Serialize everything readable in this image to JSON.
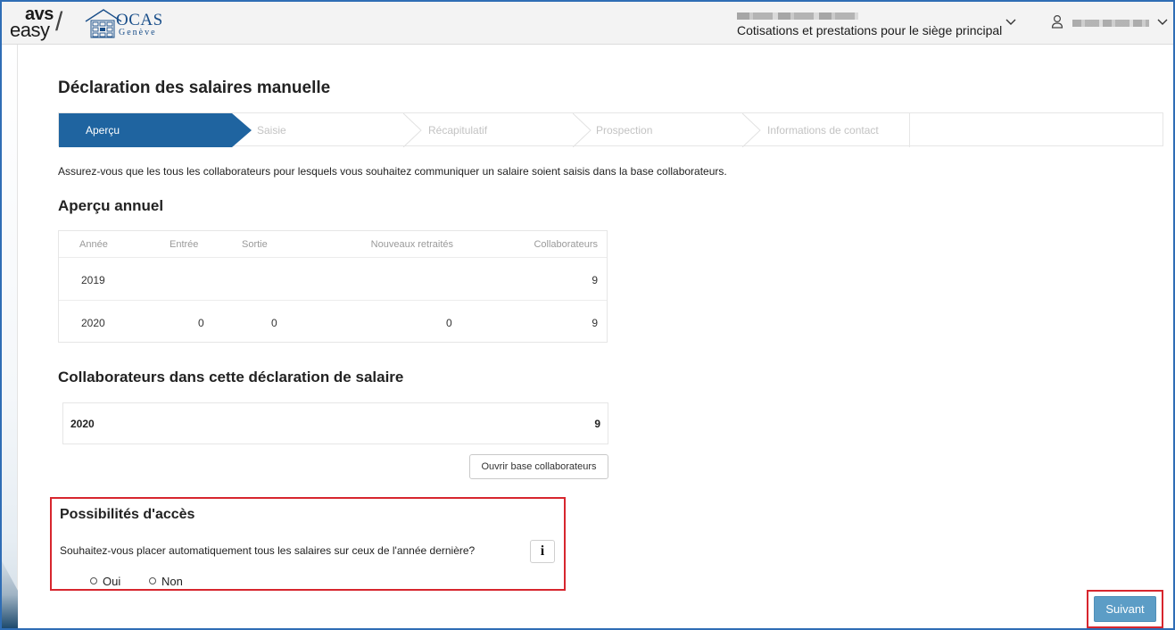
{
  "header": {
    "logo_avs": "avs",
    "logo_easy": "easy",
    "logo_slash": "/",
    "logo_ocas_name": "OCAS",
    "logo_ocas_city": "Genève",
    "org_subtitle": "Cotisations et prestations pour le siège principal"
  },
  "page": {
    "title": "Déclaration des salaires manuelle",
    "info_text": "Assurez-vous que les tous les collaborateurs pour lesquels vous souhaitez communiquer un salaire soient saisis dans la base collaborateurs."
  },
  "stepper": {
    "steps": [
      {
        "label": "Aperçu",
        "active": true
      },
      {
        "label": "Saisie",
        "active": false
      },
      {
        "label": "Récapitulatif",
        "active": false
      },
      {
        "label": "Prospection",
        "active": false
      },
      {
        "label": "Informations de contact",
        "active": false
      }
    ],
    "active_color": "#1f64a0"
  },
  "annual": {
    "heading": "Aperçu annuel",
    "columns": [
      "Année",
      "Entrée",
      "Sortie",
      "Nouveaux retraités",
      "Collaborateurs"
    ],
    "rows": [
      [
        "2019",
        "",
        "",
        "",
        "9"
      ],
      [
        "2020",
        "0",
        "0",
        "0",
        "9"
      ]
    ]
  },
  "collaborators": {
    "heading": "Collaborateurs dans cette déclaration de salaire",
    "year": "2020",
    "count": "9",
    "open_button": "Ouvrir base collaborateurs"
  },
  "access": {
    "heading": "Possibilités d'accès",
    "question": "Souhaitez-vous placer automatiquement tous les salaires sur ceux de l'année dernière?",
    "info_glyph": "i",
    "options": [
      "Oui",
      "Non"
    ]
  },
  "actions": {
    "next_label": "Suivant",
    "next_color": "#5c9dc6",
    "highlight_color": "#d7262e"
  }
}
